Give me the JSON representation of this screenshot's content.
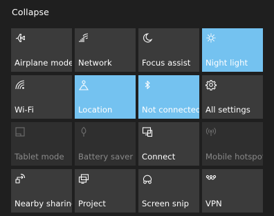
{
  "header": {
    "collapse_label": "Collapse"
  },
  "colors": {
    "background": "#1f1f1f",
    "tile": "#3b3b3b",
    "tile_active": "#74c2f0",
    "tile_disabled": "#2f2f2f"
  },
  "tiles": [
    {
      "label": "Airplane mode",
      "icon": "airplane-icon",
      "state": "normal"
    },
    {
      "label": "Network",
      "icon": "network-icon",
      "state": "normal"
    },
    {
      "label": "Focus assist",
      "icon": "moon-icon",
      "state": "normal"
    },
    {
      "label": "Night light",
      "icon": "brightness-icon",
      "state": "active"
    },
    {
      "label": "Wi-Fi",
      "icon": "wifi-icon",
      "state": "normal"
    },
    {
      "label": "Location",
      "icon": "location-icon",
      "state": "active"
    },
    {
      "label": "Not connected",
      "icon": "bluetooth-icon",
      "state": "active"
    },
    {
      "label": "All settings",
      "icon": "gear-icon",
      "state": "normal"
    },
    {
      "label": "Tablet mode",
      "icon": "tablet-mode-icon",
      "state": "disabled"
    },
    {
      "label": "Battery saver",
      "icon": "battery-saver-icon",
      "state": "disabled"
    },
    {
      "label": "Connect",
      "icon": "connect-icon",
      "state": "normal"
    },
    {
      "label": "Mobile hotspot",
      "icon": "hotspot-icon",
      "state": "disabled"
    },
    {
      "label": "Nearby sharing",
      "icon": "nearby-sharing-icon",
      "state": "normal"
    },
    {
      "label": "Project",
      "icon": "project-icon",
      "state": "normal"
    },
    {
      "label": "Screen snip",
      "icon": "screen-snip-icon",
      "state": "normal"
    },
    {
      "label": "VPN",
      "icon": "vpn-icon",
      "state": "normal"
    }
  ]
}
